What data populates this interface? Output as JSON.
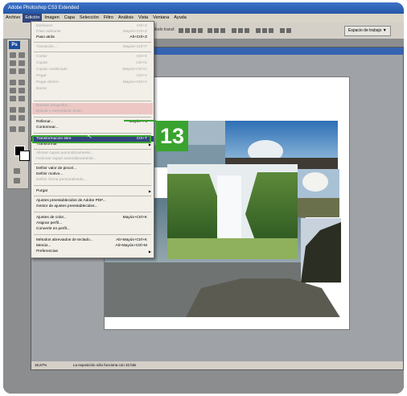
{
  "window": {
    "title": "Adobe Photoshop CS3 Extended"
  },
  "menubar": {
    "items": [
      "Archivo",
      "Edición",
      "Imagen",
      "Capa",
      "Selección",
      "Filtro",
      "Análisis",
      "Vista",
      "Ventana",
      "Ayuda"
    ]
  },
  "options_bar": {
    "mode_text": "Modo transf.",
    "workspace_label": "Espacio de trabajo ▼"
  },
  "edit_menu": {
    "items": [
      {
        "label": "Deshacer",
        "shortcut": "Ctrl+Z",
        "enabled": false
      },
      {
        "label": "Paso adelante",
        "shortcut": "Mayús+Ctrl+Z",
        "enabled": false
      },
      {
        "label": "Paso atrás",
        "shortcut": "Alt+Ctrl+Z",
        "enabled": true
      },
      {
        "label": "Transición...",
        "shortcut": "Mayús+Ctrl+F",
        "enabled": false
      },
      {
        "label": "Cortar",
        "shortcut": "Ctrl+X",
        "enabled": false
      },
      {
        "label": "Copiar",
        "shortcut": "Ctrl+C",
        "enabled": false
      },
      {
        "label": "Copiar combinado",
        "shortcut": "Mayús+Ctrl+C",
        "enabled": false
      },
      {
        "label": "Pegar",
        "shortcut": "Ctrl+V",
        "enabled": false
      },
      {
        "label": "Pegar dentro",
        "shortcut": "Mayús+Ctrl+V",
        "enabled": false
      },
      {
        "label": "Borrar",
        "shortcut": "",
        "enabled": false
      },
      {
        "label": "Revisar ortografía...",
        "shortcut": "",
        "enabled": false
      },
      {
        "label": "Buscar y reemplazar texto...",
        "shortcut": "",
        "enabled": false
      },
      {
        "label": "Rellenar...",
        "shortcut": "Mayús+F5",
        "enabled": true
      },
      {
        "label": "Contornear...",
        "shortcut": "",
        "enabled": true
      },
      {
        "label": "Transformación libre",
        "shortcut": "Ctrl+T",
        "enabled": true,
        "highlighted": true
      },
      {
        "label": "Transformar",
        "shortcut": "",
        "enabled": true,
        "submenu": true
      },
      {
        "label": "Alinear capas automáticamente...",
        "shortcut": "",
        "enabled": false
      },
      {
        "label": "Fusionar capas automáticamente...",
        "shortcut": "",
        "enabled": false
      },
      {
        "label": "Definir valor de pincel...",
        "shortcut": "",
        "enabled": true
      },
      {
        "label": "Definir motivo...",
        "shortcut": "",
        "enabled": true
      },
      {
        "label": "Definir forma personalizada...",
        "shortcut": "",
        "enabled": false
      },
      {
        "label": "Purgar",
        "shortcut": "",
        "enabled": true,
        "submenu": true
      },
      {
        "label": "Ajustes preestablecidos de Adobe PDF...",
        "shortcut": "",
        "enabled": true
      },
      {
        "label": "Gestor de ajustes preestablecidos...",
        "shortcut": "",
        "enabled": true
      },
      {
        "label": "Ajustes de color...",
        "shortcut": "Mayús+Ctrl+K",
        "enabled": true
      },
      {
        "label": "Asignar perfil...",
        "shortcut": "",
        "enabled": true
      },
      {
        "label": "Convertir en perfil...",
        "shortcut": "",
        "enabled": true
      },
      {
        "label": "Métodos abreviados de teclado...",
        "shortcut": "Alt+Mayús+Ctrl+K",
        "enabled": true
      },
      {
        "label": "Menús...",
        "shortcut": "Alt+Mayús+Ctrl+M",
        "enabled": true
      },
      {
        "label": "Preferencias",
        "shortcut": "",
        "enabled": true,
        "submenu": true
      }
    ]
  },
  "status_bar": {
    "zoom": "16,67%",
    "message": "La exposición sólo funciona con 32 bits"
  },
  "callout": {
    "number": "13"
  },
  "colors": {
    "accent_green": "#3aa32f",
    "menu_highlight": "#31457e",
    "title_blue": "#2456a6"
  }
}
